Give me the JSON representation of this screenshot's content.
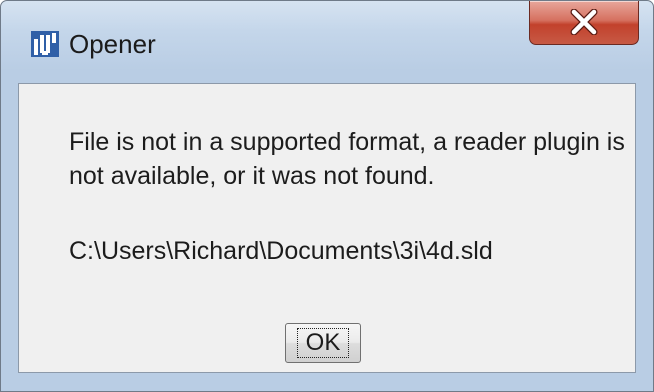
{
  "window": {
    "title": "Opener",
    "icon": "imagej-icon",
    "close_label": "close"
  },
  "dialog": {
    "message": "File is not in a supported format, a reader plugin is not available, or it was not found.",
    "path": "C:\\Users\\Richard\\Documents\\3i\\4d.sld",
    "ok_label": "OK"
  },
  "colors": {
    "frame": "#c4d6ea",
    "client": "#f0f0f0",
    "close_button": "#c7513d",
    "icon_blue": "#2f5fa7"
  }
}
